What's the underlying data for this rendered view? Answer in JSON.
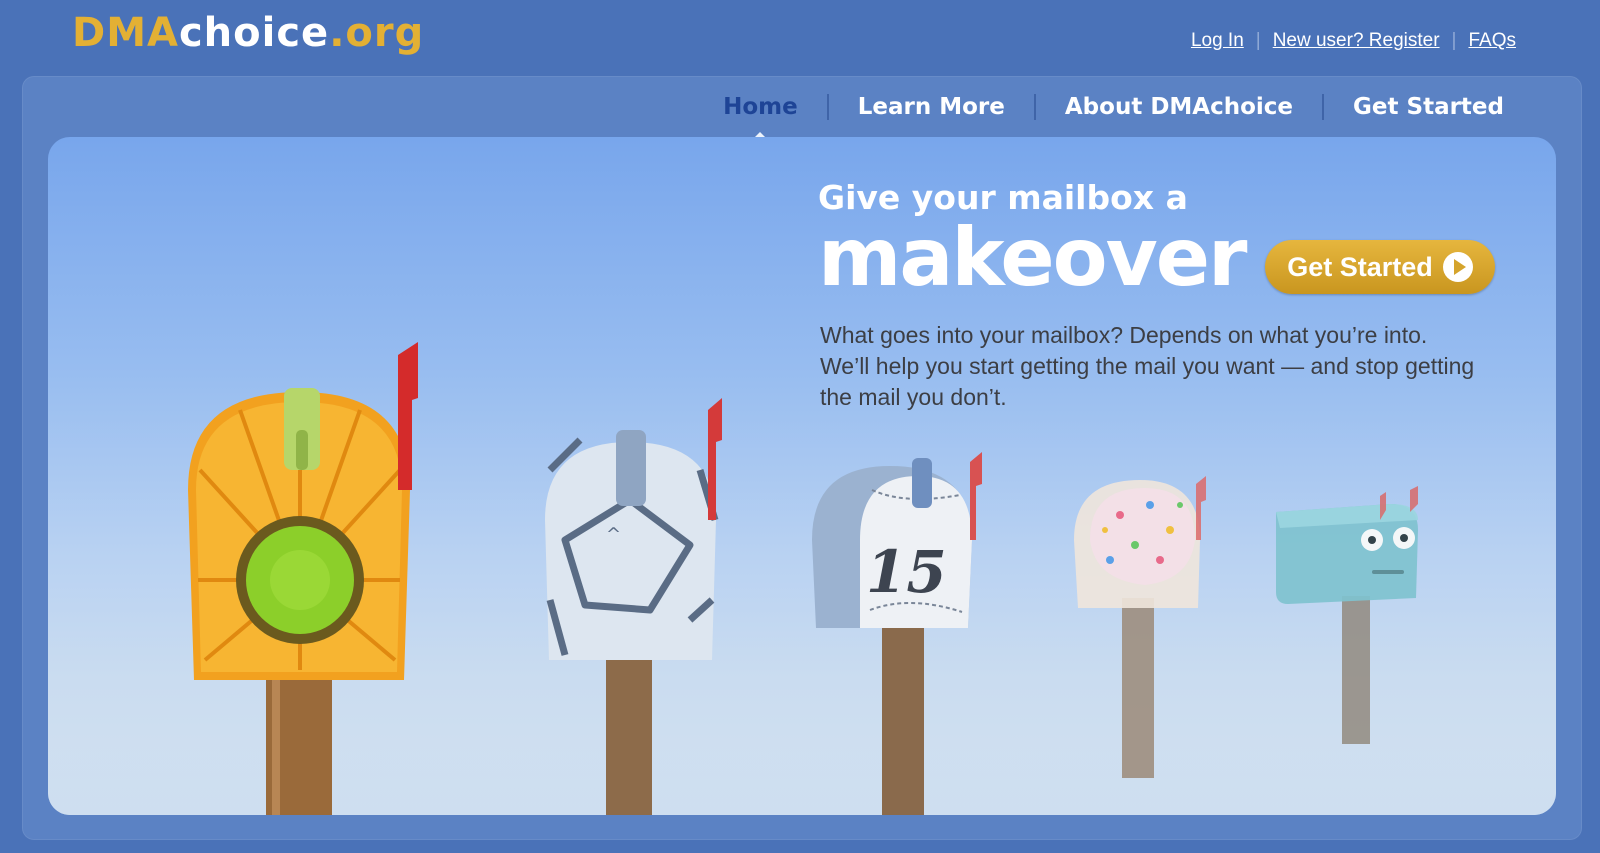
{
  "logo": {
    "part1": "DMA",
    "part2": "choice",
    "part3": ".org"
  },
  "top_links": {
    "login": "Log In",
    "register": "New user? Register",
    "faqs": "FAQs",
    "separator": "|"
  },
  "nav": {
    "items": [
      {
        "label": "Home",
        "active": true
      },
      {
        "label": "Learn More",
        "active": false
      },
      {
        "label": "About DMAchoice",
        "active": false
      },
      {
        "label": "Get Started",
        "active": false
      }
    ]
  },
  "hero": {
    "headline_small": "Give your mailbox a",
    "headline_big": "makeover",
    "cta_label": "Get Started",
    "blurb": "What goes into your mailbox? Depends on what you’re into. We’ll help you start getting the mail you want — and stop getting the mail you don’t.",
    "mailbox_number": "15",
    "mailboxes": [
      "sunflower-mailbox",
      "tile-mailbox",
      "baseball-mailbox",
      "donut-mailbox",
      "robot-mailbox"
    ]
  },
  "colors": {
    "background": "#4a72b8",
    "accent_gold": "#e3b034",
    "active_nav": "#1e4496"
  }
}
